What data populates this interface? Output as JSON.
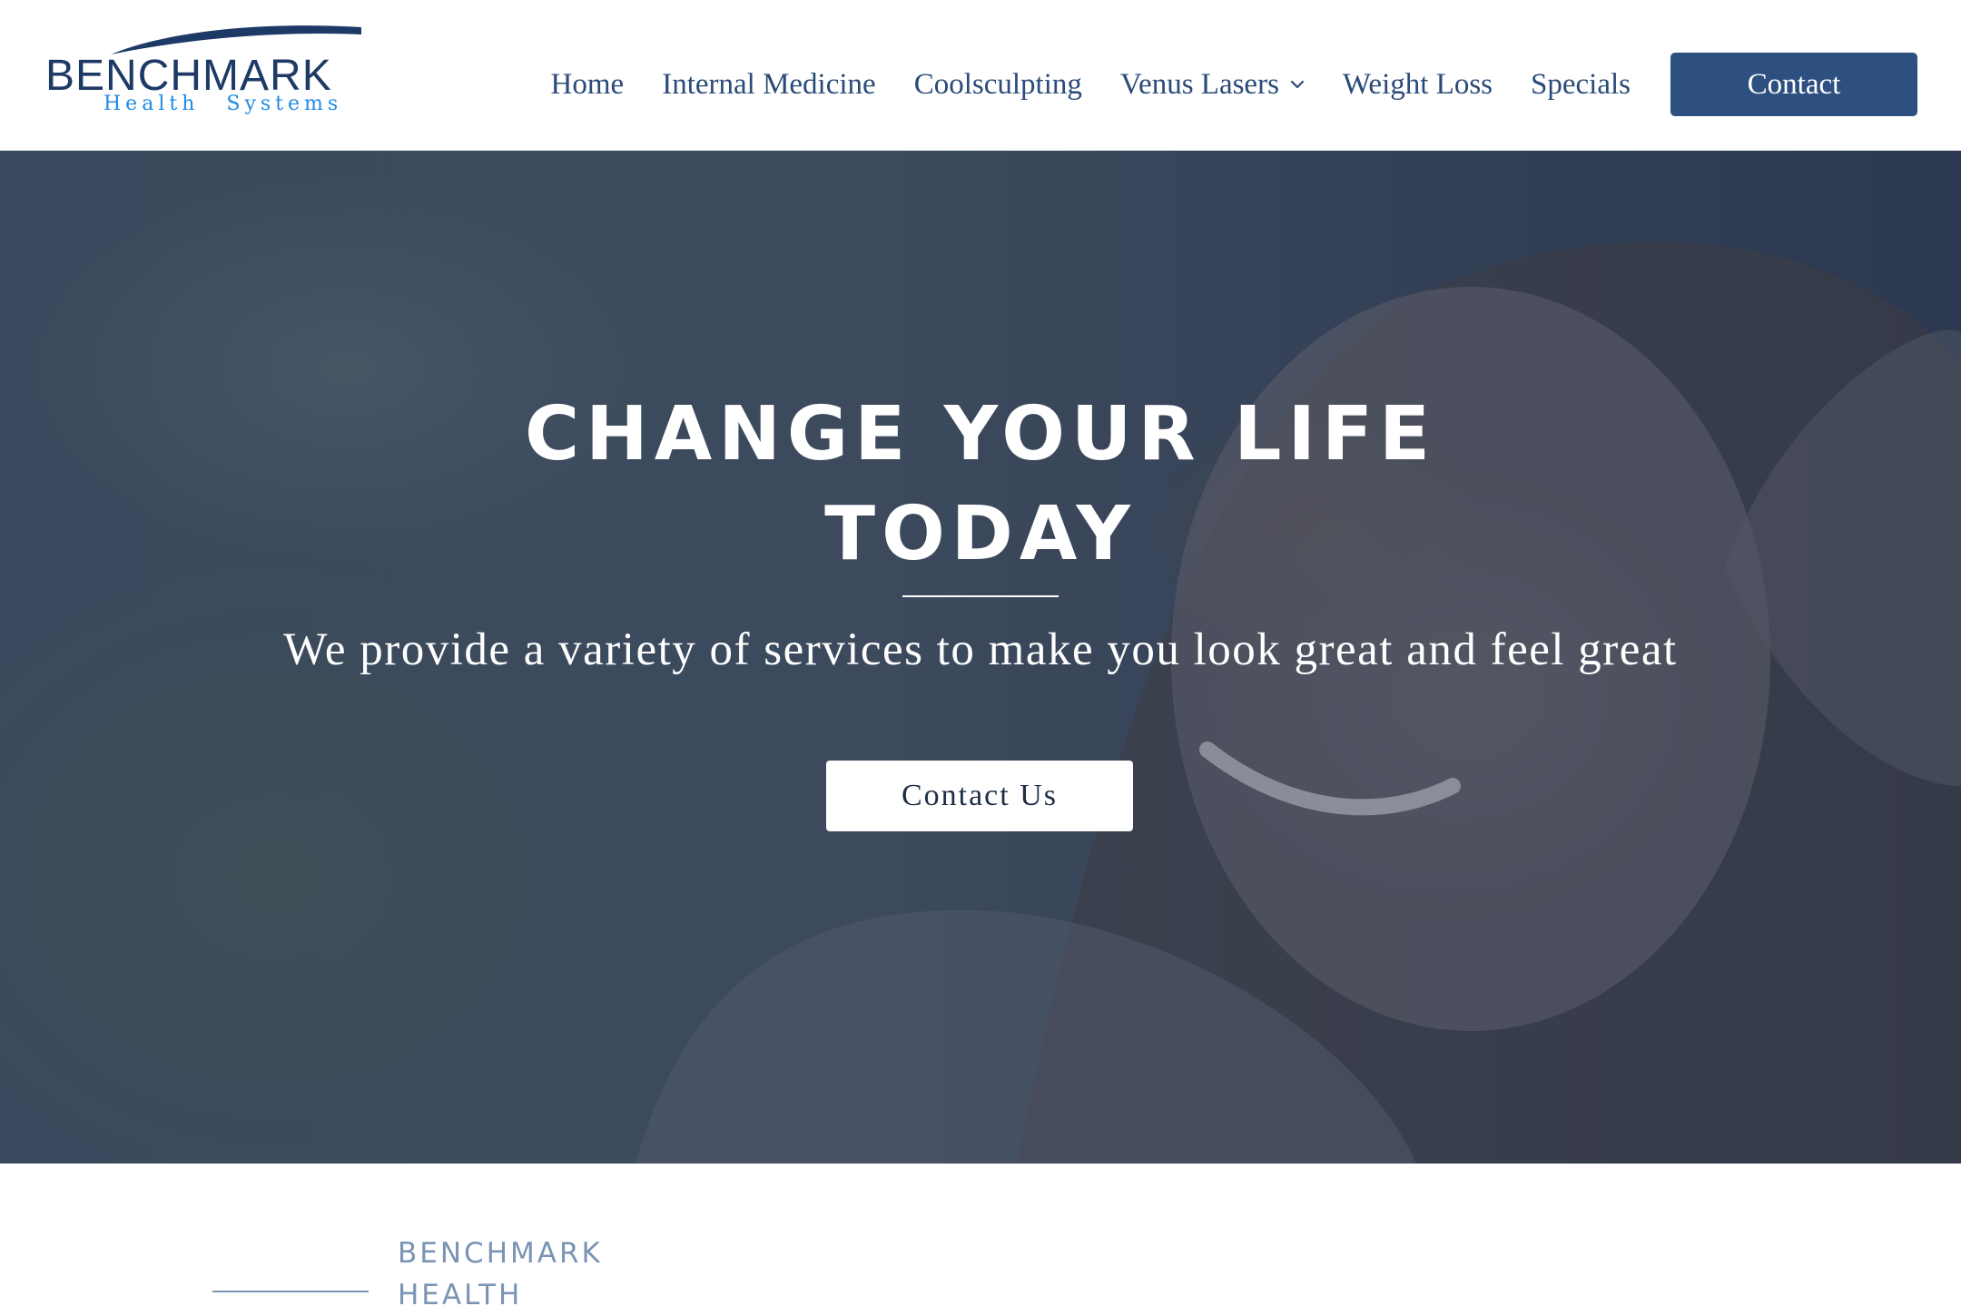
{
  "header": {
    "logo": {
      "wordmark": "BENCHMARK",
      "tagline_1": "Health",
      "tagline_2": "Systems"
    },
    "nav": {
      "items": [
        {
          "label": "Home"
        },
        {
          "label": "Internal Medicine"
        },
        {
          "label": "Coolsculpting"
        },
        {
          "label": "Venus Lasers"
        },
        {
          "label": "Weight Loss"
        },
        {
          "label": "Specials"
        }
      ],
      "contact_label": "Contact"
    }
  },
  "hero": {
    "title_line_1": "CHANGE YOUR LIFE",
    "title_line_2": "TODAY",
    "subtitle": "We provide a variety of services to make you look great and feel great",
    "button_label": "Contact Us"
  },
  "section": {
    "label_line_1": "BENCHMARK",
    "label_line_2": "HEALTH"
  },
  "colors": {
    "brand_navy": "#1d3a66",
    "brand_blue": "#1e8ae6",
    "nav_text": "#2a4a78",
    "contact_button": "#2d5080",
    "hero_overlay": "#243656",
    "section_label": "#7a94b4"
  },
  "icons": {
    "nav_dropdown": "chevron-down-icon"
  }
}
